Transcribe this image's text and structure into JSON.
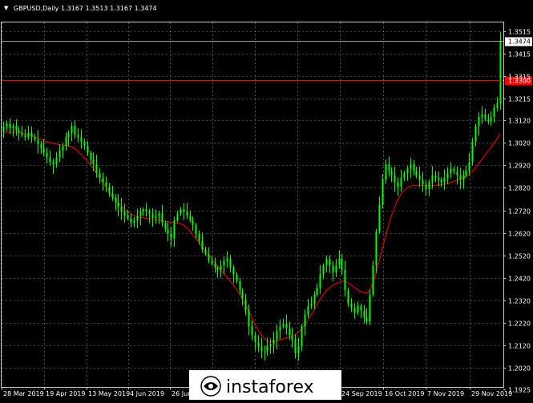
{
  "header": {
    "symbol_title": "GBPUSD,Daily",
    "ohlc": "1.3167 1.3513 1.3167 1.3474"
  },
  "watermark": {
    "brand": "instaforex",
    "icon": "instaforex-logo-icon"
  },
  "colors": {
    "background": "#000000",
    "grid": "#8a8a8a",
    "candle": "#00ff00",
    "ma_line": "#ff0000",
    "price_line": "#ff0000",
    "current_price_label_bg": "#ffffff",
    "level_label_bg": "#ff0000"
  },
  "chart_data": {
    "type": "candlestick",
    "symbol": "GBPUSD",
    "timeframe": "Daily",
    "open": 1.3167,
    "high": 1.3513,
    "low": 1.3167,
    "close": 1.3474,
    "current_price": "1.3474",
    "horizontal_level": "1.3300",
    "ylim": [
      1.1935,
      1.3555
    ],
    "y_ticks": [
      "1.3515",
      "1.3415",
      "1.3315",
      "1.3215",
      "1.3120",
      "1.3020",
      "1.2920",
      "1.2820",
      "1.2720",
      "1.2620",
      "1.2520",
      "1.2420",
      "1.2320",
      "1.2220",
      "1.2120",
      "1.2020",
      "1.1925"
    ],
    "x_ticks": [
      "28 Mar 2019",
      "19 Apr 2019",
      "13 May 2019",
      "4 Jun 2019",
      "26 Jun 2019",
      "24 Sep 2019",
      "16 Oct 2019",
      "7 Nov 2019",
      "29 Nov 2019"
    ],
    "close_series": [
      1.309,
      1.3105,
      1.3085,
      1.3095,
      1.3075,
      1.3065,
      1.3055,
      1.3045,
      1.3065,
      1.3045,
      1.3035,
      1.3015,
      1.2995,
      1.2975,
      1.2955,
      1.2935,
      1.2925,
      1.2955,
      1.2985,
      1.3005,
      1.3045,
      1.3065,
      1.3095,
      1.3055,
      1.3045,
      1.3025,
      1.3005,
      1.2975,
      1.2945,
      1.2925,
      1.2885,
      1.2865,
      1.2845,
      1.2825,
      1.2795,
      1.2775,
      1.2755,
      1.2735,
      1.2715,
      1.2695,
      1.2685,
      1.2665,
      1.2675,
      1.2695,
      1.2715,
      1.2725,
      1.2715,
      1.2705,
      1.2685,
      1.2695,
      1.2705,
      1.2665,
      1.2635,
      1.2615,
      1.2595,
      1.2675,
      1.2705,
      1.2725,
      1.2715,
      1.2695,
      1.2675,
      1.2655,
      1.2615,
      1.2585,
      1.2545,
      1.2525,
      1.2495,
      1.2485,
      1.2465,
      1.2455,
      1.2475,
      1.2495,
      1.2505,
      1.2465,
      1.2435,
      1.2405,
      1.2365,
      1.2325,
      1.2275,
      1.2205,
      1.2165,
      1.2135,
      1.2115,
      1.2095,
      1.2095,
      1.2115,
      1.2125,
      1.2145,
      1.2185,
      1.2205,
      1.2215,
      1.2195,
      1.2165,
      1.2145,
      1.2085,
      1.2115,
      1.2205,
      1.2255,
      1.2295,
      1.2305,
      1.2345,
      1.2375,
      1.2435,
      1.2475,
      1.2505,
      1.2475,
      1.2445,
      1.2475,
      1.2505,
      1.2455,
      1.2365,
      1.2305,
      1.2285,
      1.2265,
      1.2295,
      1.2275,
      1.2245,
      1.2225,
      1.2345,
      1.2475,
      1.2625,
      1.2745,
      1.2855,
      1.2925,
      1.2895,
      1.2875,
      1.2845,
      1.2825,
      1.2865,
      1.2885,
      1.2905,
      1.2925,
      1.2895,
      1.2875,
      1.2855,
      1.2835,
      1.2815,
      1.2845,
      1.2875,
      1.2865,
      1.2855,
      1.2845,
      1.2865,
      1.2885,
      1.2905,
      1.2895,
      1.2875,
      1.2855,
      1.2875,
      1.2895,
      1.2935,
      1.3025,
      1.3095,
      1.3135,
      1.3145,
      1.3125,
      1.3115,
      1.3135,
      1.3175,
      1.3195,
      1.3474
    ],
    "ma_series": [
      1.3065,
      1.3068,
      1.3068,
      1.3067,
      1.3067,
      1.3066,
      1.3063,
      1.306,
      1.3058,
      1.3054,
      1.3048,
      1.3042,
      1.3036,
      1.303,
      1.3025,
      1.3021,
      1.3018,
      1.3015,
      1.3012,
      1.301,
      1.3008,
      1.3006,
      1.3003,
      1.2995,
      1.2985,
      1.297,
      1.2955,
      1.294,
      1.2925,
      1.2905,
      1.2885,
      1.2865,
      1.2845,
      1.2825,
      1.2805,
      1.2787,
      1.277,
      1.2755,
      1.274,
      1.2725,
      1.2713,
      1.2705,
      1.2698,
      1.2693,
      1.269,
      1.2687,
      1.2685,
      1.2683,
      1.268,
      1.2678,
      1.2676,
      1.2674,
      1.2672,
      1.267,
      1.2667,
      1.2665,
      1.2663,
      1.2661,
      1.2655,
      1.2645,
      1.263,
      1.2612,
      1.2595,
      1.2578,
      1.256,
      1.2542,
      1.2525,
      1.2508,
      1.249,
      1.2472,
      1.2455,
      1.244,
      1.2425,
      1.2408,
      1.239,
      1.2372,
      1.235,
      1.2325,
      1.23,
      1.2275,
      1.2245,
      1.2215,
      1.219,
      1.2168,
      1.2152,
      1.214,
      1.2135,
      1.2135,
      1.2138,
      1.2143,
      1.2148,
      1.2152,
      1.2157,
      1.2163,
      1.2168,
      1.2178,
      1.2192,
      1.221,
      1.223,
      1.2252,
      1.2275,
      1.23,
      1.2325,
      1.2345,
      1.2362,
      1.2375,
      1.2385,
      1.2393,
      1.24,
      1.2405,
      1.2405,
      1.2398,
      1.2388,
      1.2378,
      1.2368,
      1.236,
      1.2355,
      1.2352,
      1.2365,
      1.2395,
      1.244,
      1.249,
      1.2545,
      1.26,
      1.265,
      1.2695,
      1.2733,
      1.2765,
      1.279,
      1.2808,
      1.282,
      1.2827,
      1.283,
      1.2831,
      1.2831,
      1.283,
      1.2829,
      1.2829,
      1.283,
      1.2831,
      1.2832,
      1.2834,
      1.2836,
      1.2839,
      1.2843,
      1.2848,
      1.2853,
      1.2858,
      1.2865,
      1.2872,
      1.288,
      1.2892,
      1.2908,
      1.2926,
      1.2945,
      1.2963,
      1.298,
      1.2998,
      1.3018,
      1.3038,
      1.306
    ]
  }
}
